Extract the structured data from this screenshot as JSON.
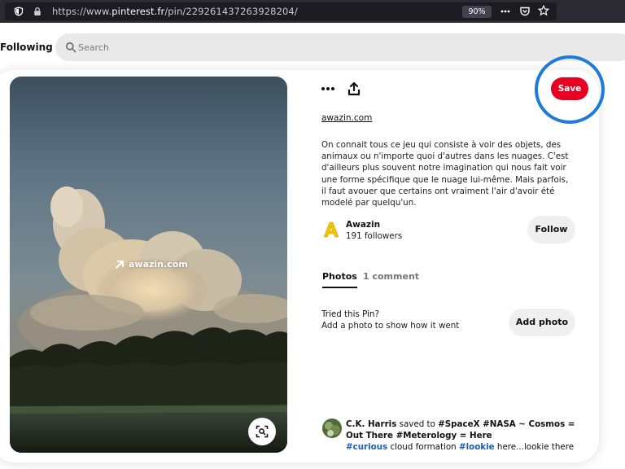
{
  "browser": {
    "url_prefix": "https://www.",
    "url_host": "pinterest.fr",
    "url_path": "/pin/229261437263928204/",
    "zoom": "90%",
    "icons": [
      "shield-icon",
      "lock-icon",
      "more-icon",
      "pocket-icon",
      "bookmark-star-icon"
    ]
  },
  "header": {
    "following_label": "Following",
    "search_placeholder": "Search"
  },
  "pin": {
    "image_link_label": "awazin.com",
    "source_link": "awazin.com",
    "description": "On connait tous ce jeu qui consiste à voir des objets, des animaux ou n'importe quoi d'autres dans les nuages. C'est d'ailleurs plus souvent notre imagination qui nous fait voir une forme spécifique que le nuage lui-même. Mais parfois, il faut avouer que certains ont vraiment l'air d'avoir été modelé par quelqu'un.",
    "save_label": "Save",
    "accent_color": "#e60023",
    "ring_color": "#1f7ad8"
  },
  "creator": {
    "name": "Awazin",
    "followers": "191 followers",
    "follow_label": "Follow"
  },
  "tabs": {
    "photos": "Photos",
    "comments": "1 comment"
  },
  "tried": {
    "title": "Tried this Pin?",
    "subtitle": "Add a photo to show how it went",
    "add_photo_label": "Add photo"
  },
  "activity": {
    "user": "C.K. Harris",
    "saved_to": "saved to",
    "board": "#SpaceX #NASA ~ Cosmos = Out There #Meterology = Here",
    "tag1": "#curious",
    "text1": "cloud formation",
    "tag2": "#lookie",
    "text2": "here...lookie there"
  }
}
